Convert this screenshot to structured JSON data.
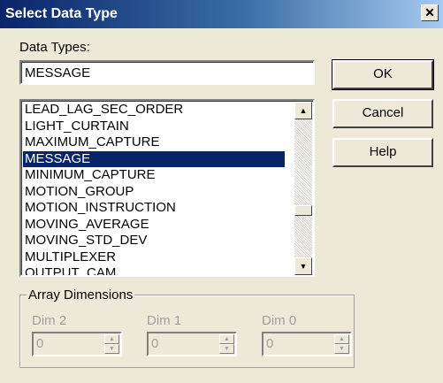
{
  "window": {
    "title": "Select Data Type",
    "close_glyph": "✕"
  },
  "type_field": {
    "label": "Data Types:",
    "value": "MESSAGE"
  },
  "buttons": {
    "ok": "OK",
    "cancel": "Cancel",
    "help": "Help"
  },
  "type_list": {
    "items": [
      "LEAD_LAG_SEC_ORDER",
      "LIGHT_CURTAIN",
      "MAXIMUM_CAPTURE",
      "MESSAGE",
      "MINIMUM_CAPTURE",
      "MOTION_GROUP",
      "MOTION_INSTRUCTION",
      "MOVING_AVERAGE",
      "MOVING_STD_DEV",
      "MULTIPLEXER",
      "OUTPUT_CAM"
    ],
    "selected": "MESSAGE"
  },
  "array_dimensions": {
    "label": "Array Dimensions",
    "dims": [
      {
        "label": "Dim 2",
        "value": "0"
      },
      {
        "label": "Dim 1",
        "value": "0"
      },
      {
        "label": "Dim 0",
        "value": "0"
      }
    ]
  },
  "icons": {
    "scroll_up": "up-arrow",
    "scroll_down": "down-arrow",
    "close": "close-x"
  }
}
